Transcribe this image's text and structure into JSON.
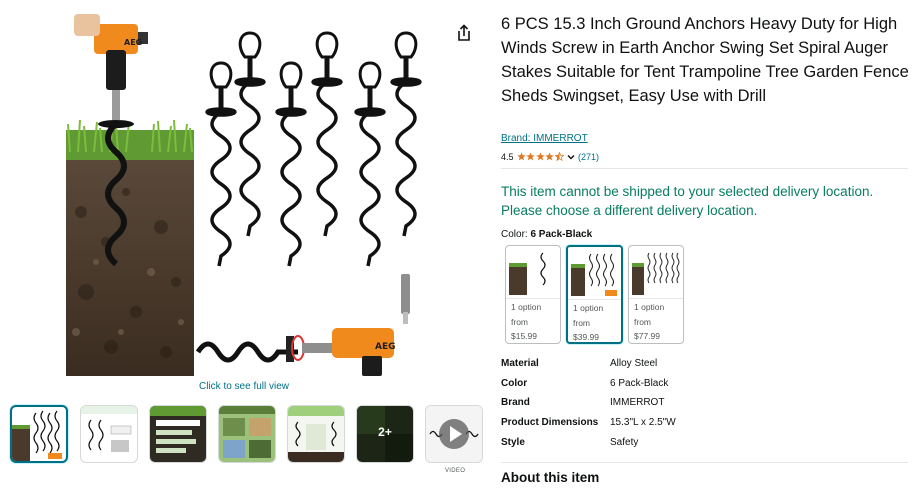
{
  "product": {
    "title": "6 PCS 15.3 Inch Ground Anchors Heavy Duty for High Winds Screw in Earth Anchor Swing Set Spiral Auger Stakes Suitable for Tent Trampoline Tree Garden Fence Sheds Swingset, Easy Use with Drill",
    "brand_link": "Brand: IMMERROT",
    "rating_value": "4.5",
    "rating_stars": 4.5,
    "rating_count": "(271)"
  },
  "gallery": {
    "see_full_view": "Click to see full view",
    "drill_brand": "AEG",
    "more_count": "2+",
    "video_label": "VIDEO"
  },
  "shipping": {
    "message": "This item cannot be shipped to your selected delivery location. Please choose a different delivery location."
  },
  "color": {
    "label": "Color:",
    "selected": "6 Pack-Black",
    "options": [
      {
        "line1": "1 option",
        "line2": "from",
        "price": "$15.99"
      },
      {
        "line1": "1 option",
        "line2": "from",
        "price": "$39.99"
      },
      {
        "line1": "1 option",
        "line2": "from",
        "price": "$77.99"
      }
    ]
  },
  "specs": [
    {
      "key": "Material",
      "value": "Alloy Steel"
    },
    {
      "key": "Color",
      "value": "6 Pack-Black"
    },
    {
      "key": "Brand",
      "value": "IMMERROT"
    },
    {
      "key": "Product Dimensions",
      "value": "15.3\"L x 2.5\"W"
    },
    {
      "key": "Style",
      "value": "Safety"
    }
  ],
  "about": {
    "heading": "About this item"
  },
  "colors": {
    "link": "#007185",
    "ship_message": "#067d62",
    "star": "#de7921",
    "drill_orange": "#f08a1c",
    "selected_border": "#007185"
  },
  "icons": [
    "share-icon",
    "star-icon",
    "chevron-down-icon",
    "play-icon"
  ]
}
